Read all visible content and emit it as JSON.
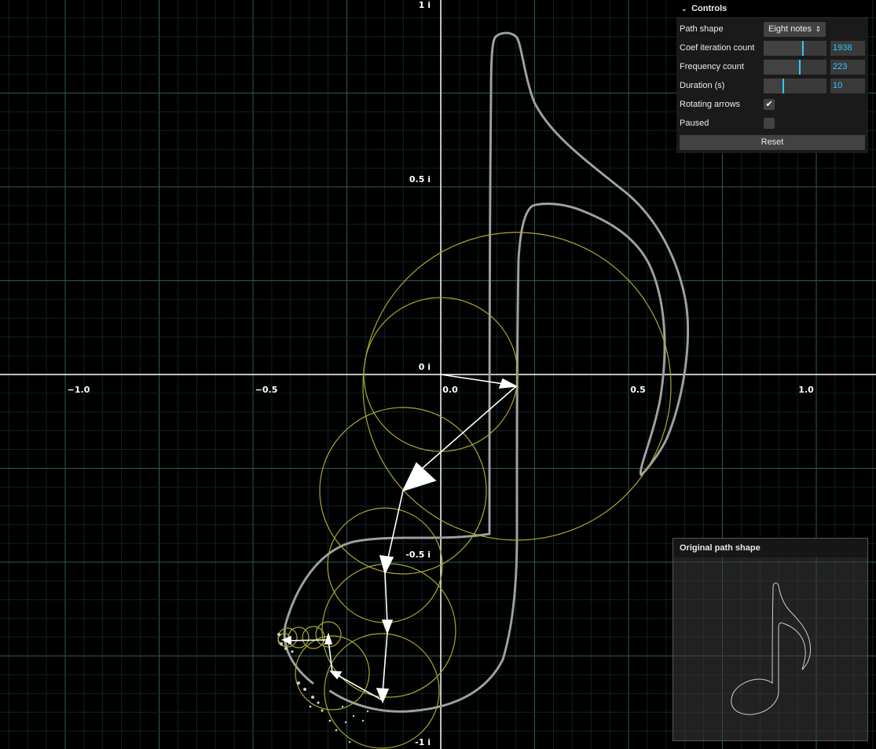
{
  "canvas": {
    "x_tick_labels": [
      "−1.0",
      "−0.5",
      "0.0",
      "0.5",
      "1.0"
    ],
    "y_tick_labels": [
      "1 i",
      "0.5 i",
      "0 i",
      "-0.5 i",
      "-1 i"
    ]
  },
  "controls": {
    "title": "Controls",
    "path_shape": {
      "label": "Path shape",
      "value": "Eight notes"
    },
    "coef_iteration_count": {
      "label": "Coef iteration count",
      "value": "1938",
      "fraction": 0.62
    },
    "frequency_count": {
      "label": "Frequency count",
      "value": "223",
      "fraction": 0.57
    },
    "duration": {
      "label": "Duration (s)",
      "value": "10",
      "fraction": 0.31
    },
    "rotating_arrows": {
      "label": "Rotating arrows",
      "checked": true
    },
    "paused": {
      "label": "Paused",
      "checked": false
    },
    "reset_label": "Reset"
  },
  "original_panel": {
    "title": "Original path shape"
  },
  "colors": {
    "background": "#000000",
    "grid_minor": "#0f2b2b",
    "grid_major": "#2c5a5a",
    "axis": "#ffffff",
    "circles": "#a8a832",
    "arrows": "#ffffff",
    "trace": "#9a9a9a",
    "accent": "#2cc9ff"
  }
}
